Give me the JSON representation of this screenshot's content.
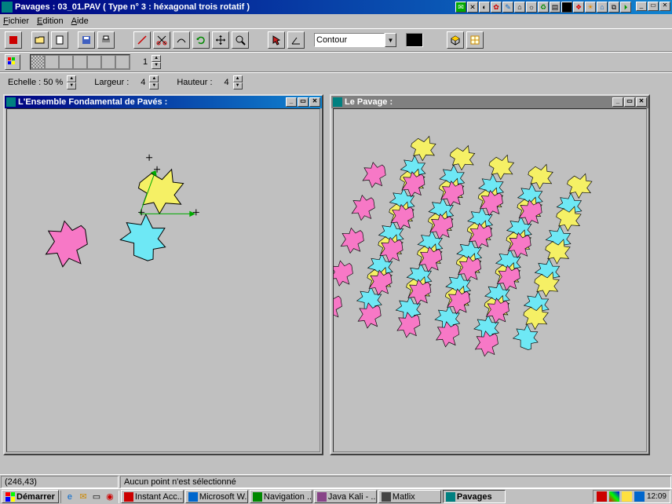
{
  "app": {
    "title": "Pavages :   03_01.PAV        ( Type  n°  3 :   héxagonal trois rotatif )"
  },
  "menus": [
    "Fichier",
    "Edition",
    "Aide"
  ],
  "toolbar": {
    "combo_value": "Contour"
  },
  "toolbar2": {
    "palette_index": "1"
  },
  "params": {
    "echelle_label": "Echelle :",
    "echelle_value": "50 %",
    "largeur_label": "Largeur :",
    "largeur_value": "4",
    "hauteur_label": "Hauteur :",
    "hauteur_value": "4"
  },
  "windows": {
    "fundamental": {
      "title": "L'Ensemble Fondamental de Pavés :"
    },
    "pavage": {
      "title": "Le Pavage :"
    }
  },
  "status": {
    "coords": "(246,43)",
    "message": "Aucun point n'est sélectionné"
  },
  "taskbar": {
    "start": "Démarrer",
    "tasks": [
      {
        "label": "Instant Acc..."
      },
      {
        "label": "Microsoft W..."
      },
      {
        "label": "Navigation ..."
      },
      {
        "label": "Java Kali - ..."
      },
      {
        "label": "Matlix"
      },
      {
        "label": "Pavages"
      }
    ],
    "clock": "12:09"
  },
  "colors": {
    "yellow": "#f5f065",
    "pink": "#f778c6",
    "cyan": "#6ee8f5"
  }
}
